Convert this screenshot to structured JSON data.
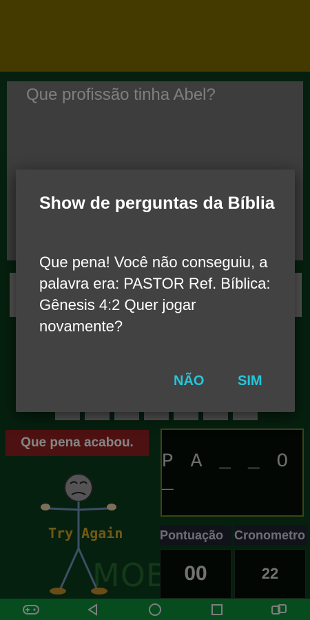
{
  "game": {
    "question_partial": "Que profissão tinha Abel?",
    "status_banner": "Que pena acabou.",
    "word_display": "P A _ _ O _",
    "mascot_caption": "Try Again",
    "watermark": "MOBJOG",
    "score_label": "Pontuação",
    "timer_label": "Cronometro",
    "score_value": "00",
    "timer_value": "22"
  },
  "dialog": {
    "title": "Show de perguntas da Bíblia",
    "message": "Que pena! Você não conseguiu, a palavra era: PASTOR Ref. Bíblica: Gênesis 4:2 Quer jogar novamente?",
    "negative_label": "NÃO",
    "positive_label": "SIM"
  },
  "colors": {
    "accent": "#26c6da",
    "top_bar": "#7c6a00",
    "background": "#0b3b1c",
    "banner": "#8e1f1f",
    "nav_bar": "#0d8b3a"
  },
  "nav": {
    "icons": [
      "gamepad-icon",
      "back-icon",
      "home-icon",
      "recents-icon",
      "screen-rotate-icon"
    ]
  }
}
